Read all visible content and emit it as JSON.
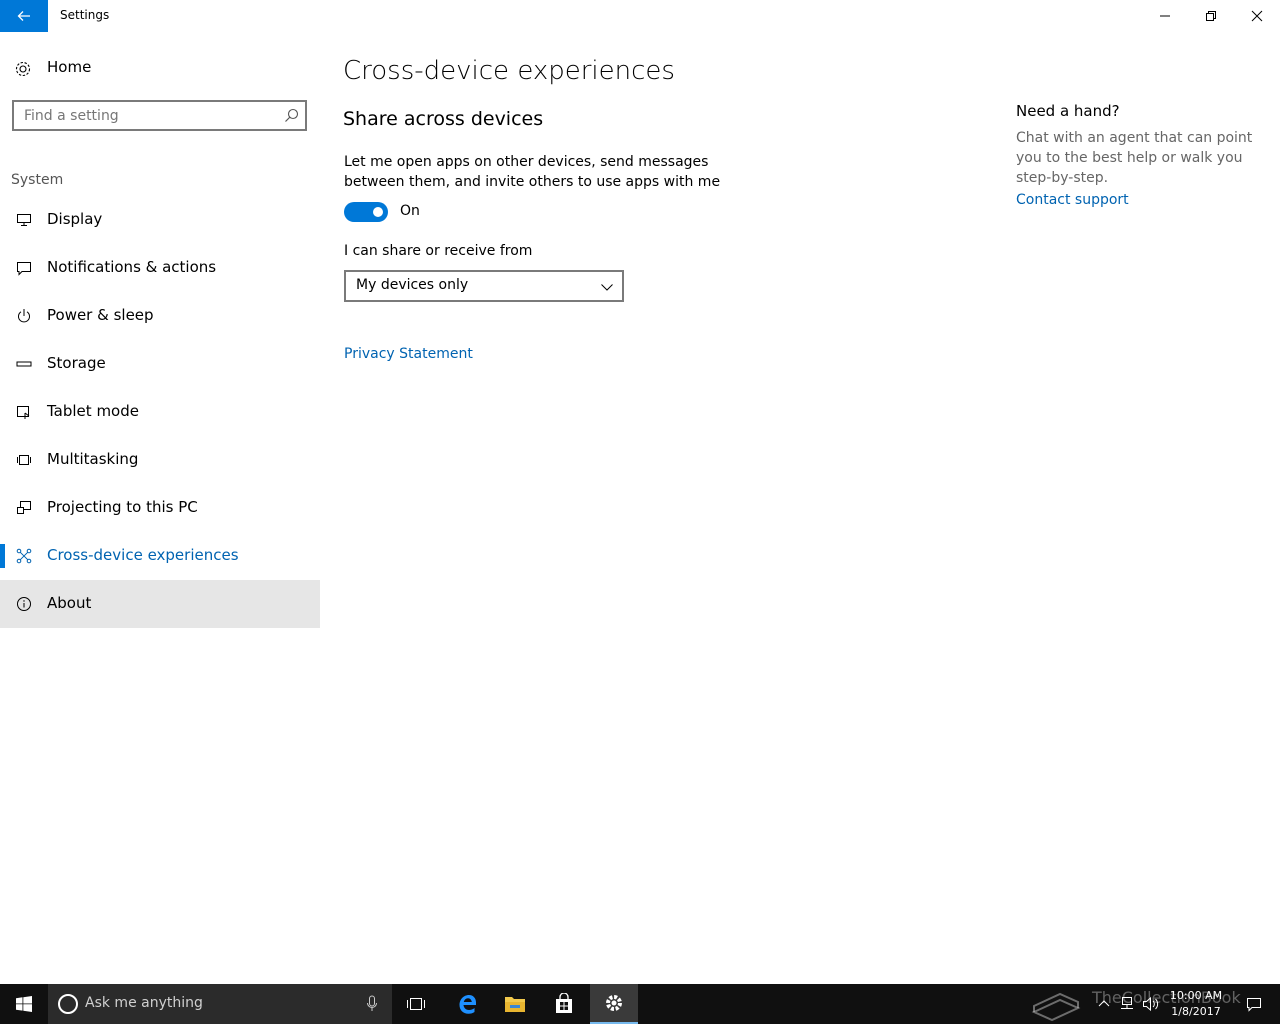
{
  "window": {
    "title": "Settings"
  },
  "sidebar": {
    "home_label": "Home",
    "search_placeholder": "Find a setting",
    "section_label": "System",
    "items": [
      {
        "label": "Display",
        "icon": "display-icon"
      },
      {
        "label": "Notifications & actions",
        "icon": "notifications-icon"
      },
      {
        "label": "Power & sleep",
        "icon": "power-icon"
      },
      {
        "label": "Storage",
        "icon": "storage-icon"
      },
      {
        "label": "Tablet mode",
        "icon": "tablet-mode-icon"
      },
      {
        "label": "Multitasking",
        "icon": "multitasking-icon"
      },
      {
        "label": "Projecting to this PC",
        "icon": "projecting-icon"
      },
      {
        "label": "Cross-device experiences",
        "icon": "cross-device-icon",
        "active": true
      },
      {
        "label": "About",
        "icon": "info-icon",
        "hover": true
      }
    ]
  },
  "main": {
    "page_title": "Cross-device experiences",
    "section_title": "Share across devices",
    "description": "Let me open apps on other devices, send messages between them, and invite others to use apps with me",
    "toggle_state": "On",
    "share_label": "I can share or receive from",
    "dropdown_value": "My devices only",
    "privacy_link": "Privacy Statement"
  },
  "help": {
    "title": "Need a hand?",
    "description": "Chat with an agent that can point you to the best help or walk you step-by-step.",
    "link": "Contact support"
  },
  "taskbar": {
    "search_placeholder": "Ask me anything",
    "time": "10:00 AM",
    "date": "1/8/2017",
    "watermark": "TheCollectionBook"
  },
  "colors": {
    "accent": "#0078d7",
    "link": "#0063b1",
    "taskbar": "#101010"
  }
}
